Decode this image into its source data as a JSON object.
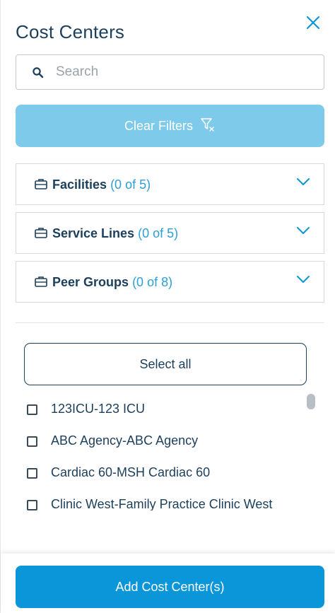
{
  "panel": {
    "title": "Cost Centers",
    "close_icon": "close-icon"
  },
  "search": {
    "placeholder": "Search",
    "value": "",
    "icon": "search-icon"
  },
  "clear_filters": {
    "label": "Clear Filters",
    "icon": "filter-clear-icon"
  },
  "filters": [
    {
      "name": "Facilities",
      "count": "(0 of 5)",
      "icon": "briefcase-icon"
    },
    {
      "name": "Service Lines",
      "count": "(0 of 5)",
      "icon": "briefcase-icon"
    },
    {
      "name": "Peer Groups",
      "count": "(0 of 8)",
      "icon": "briefcase-icon"
    }
  ],
  "select_all_label": "Select all",
  "cost_centers": [
    {
      "label": "123ICU-123 ICU",
      "checked": false
    },
    {
      "label": "ABC Agency-ABC Agency",
      "checked": false
    },
    {
      "label": "Cardiac 60-MSH Cardiac 60",
      "checked": false
    },
    {
      "label": "Clinic West-Family Practice Clinic West",
      "checked": false
    }
  ],
  "footer": {
    "add_label": "Add Cost Center(s)"
  },
  "colors": {
    "primary": "#0a96d9",
    "primary_disabled": "#7ecaeb",
    "text": "#1c3f5c",
    "count": "#2b9fd6"
  }
}
